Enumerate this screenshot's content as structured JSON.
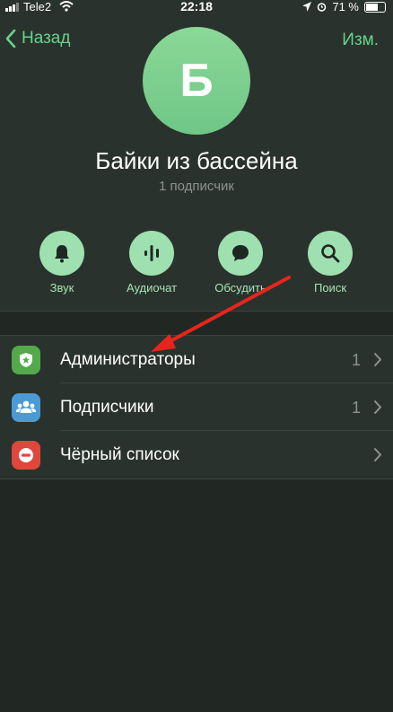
{
  "status_bar": {
    "carrier": "Tele2",
    "time": "22:18",
    "battery": "71 %",
    "battery_level": 0.71
  },
  "nav": {
    "back_label": "Назад",
    "edit_label": "Изм."
  },
  "channel": {
    "avatar_letter": "Б",
    "title": "Байки из бассейна",
    "subtitle": "1 подписчик"
  },
  "actions": [
    {
      "label": "Звук",
      "icon": "bell-icon"
    },
    {
      "label": "Аудиочат",
      "icon": "audio-wave-icon"
    },
    {
      "label": "Обсудить",
      "icon": "chat-bubble-icon"
    },
    {
      "label": "Поиск",
      "icon": "search-icon"
    }
  ],
  "menu": [
    {
      "label": "Администраторы",
      "count": "1",
      "icon": "admin-shield-icon",
      "color": "#54a94b"
    },
    {
      "label": "Подписчики",
      "count": "1",
      "icon": "subscribers-icon",
      "color": "#4a9ad6"
    },
    {
      "label": "Чёрный список",
      "count": "",
      "icon": "blacklist-icon",
      "color": "#e0473c"
    }
  ],
  "colors": {
    "accent": "#67d38a",
    "annotation_arrow": "#e8251d"
  }
}
